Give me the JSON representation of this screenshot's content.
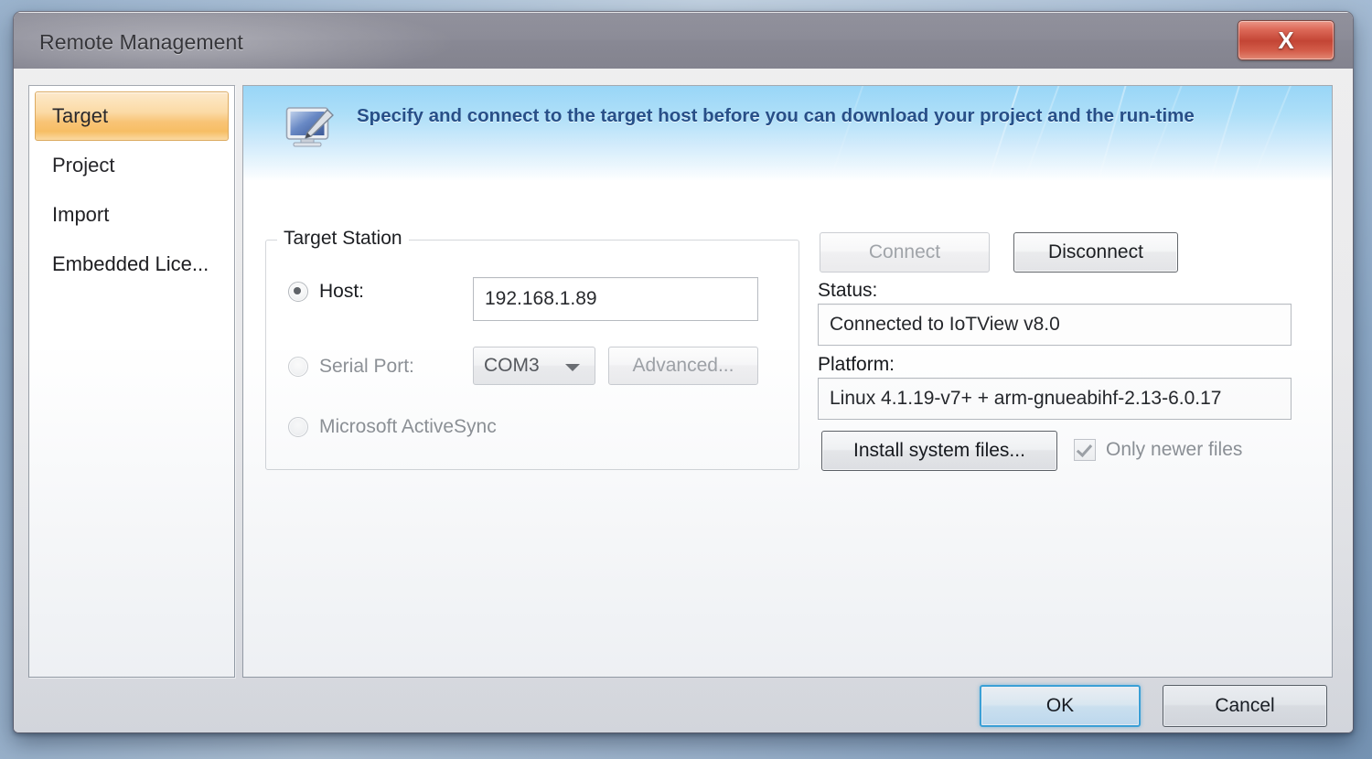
{
  "window": {
    "title": "Remote Management",
    "close_label": "X",
    "close_icon": "close-icon"
  },
  "sidebar": {
    "items": [
      {
        "label": "Target",
        "selected": true
      },
      {
        "label": "Project",
        "selected": false
      },
      {
        "label": "Import",
        "selected": false
      },
      {
        "label": "Embedded Lice...",
        "selected": false
      }
    ]
  },
  "banner": {
    "icon": "monitor-stylus-icon",
    "text": "Specify and connect to the target host before you can download your project and the run-time",
    "accent_color": "#14407e"
  },
  "target_station": {
    "legend": "Target Station",
    "host": {
      "radio_label": "Host:",
      "selected": true,
      "value": "192.168.1.89",
      "placeholder": ""
    },
    "serial_port": {
      "radio_label": "Serial Port:",
      "selected": false,
      "disabled": true,
      "value": "COM3",
      "options": [
        "COM3"
      ],
      "advanced_label": "Advanced..."
    },
    "activesync": {
      "radio_label": "Microsoft ActiveSync",
      "selected": false,
      "disabled": true
    }
  },
  "connection": {
    "connect_label": "Connect",
    "connect_disabled": true,
    "disconnect_label": "Disconnect",
    "disconnect_disabled": false,
    "status_label": "Status:",
    "status_value": "Connected to IoTView v8.0",
    "platform_label": "Platform:",
    "platform_value": "Linux 4.1.19-v7+ + arm-gnueabihf-2.13-6.0.17",
    "install_label": "Install system files...",
    "only_newer_label": "Only newer files",
    "only_newer_checked": true,
    "only_newer_disabled": true
  },
  "footer": {
    "ok_label": "OK",
    "cancel_label": "Cancel"
  },
  "colors": {
    "titlebar": "#7c7c89",
    "close_red": "#bc2f1d",
    "selection_orange": "#f8bf6b",
    "banner_blue": "#8fd2f6",
    "default_button_blue": "#3ca8e0"
  }
}
